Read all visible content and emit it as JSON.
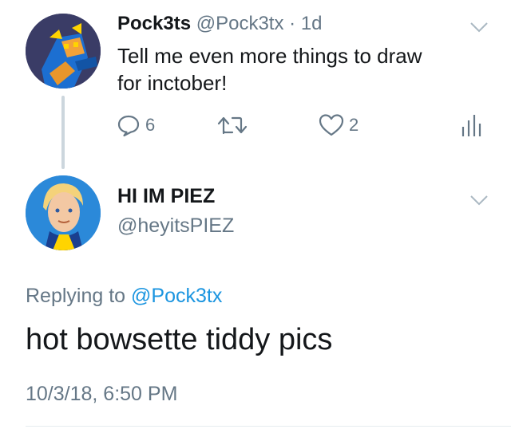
{
  "parent_tweet": {
    "display_name": "Pock3ts",
    "handle": "@Pock3tx",
    "separator": "·",
    "time": "1d",
    "text_line1": "Tell me even more things to draw",
    "text_line2": "for inctober!",
    "actions": {
      "reply_icon": "reply-icon",
      "reply_count": "6",
      "retweet_icon": "retweet-icon",
      "like_icon": "heart-icon",
      "like_count": "2",
      "analytics_icon": "analytics-icon"
    }
  },
  "reply_tweet": {
    "display_name": "HI IM PIEZ",
    "handle": "@heyitsPIEZ",
    "replying_prefix": "Replying to",
    "replying_to": "@Pock3tx",
    "text": "hot bowsette tiddy pics",
    "timestamp": "10/3/18, 6:50 PM"
  },
  "colors": {
    "text": "#14171a",
    "muted": "#657786",
    "link": "#1b95e0",
    "thread_line": "#ccd6dd",
    "divider": "#e6ecf0"
  }
}
